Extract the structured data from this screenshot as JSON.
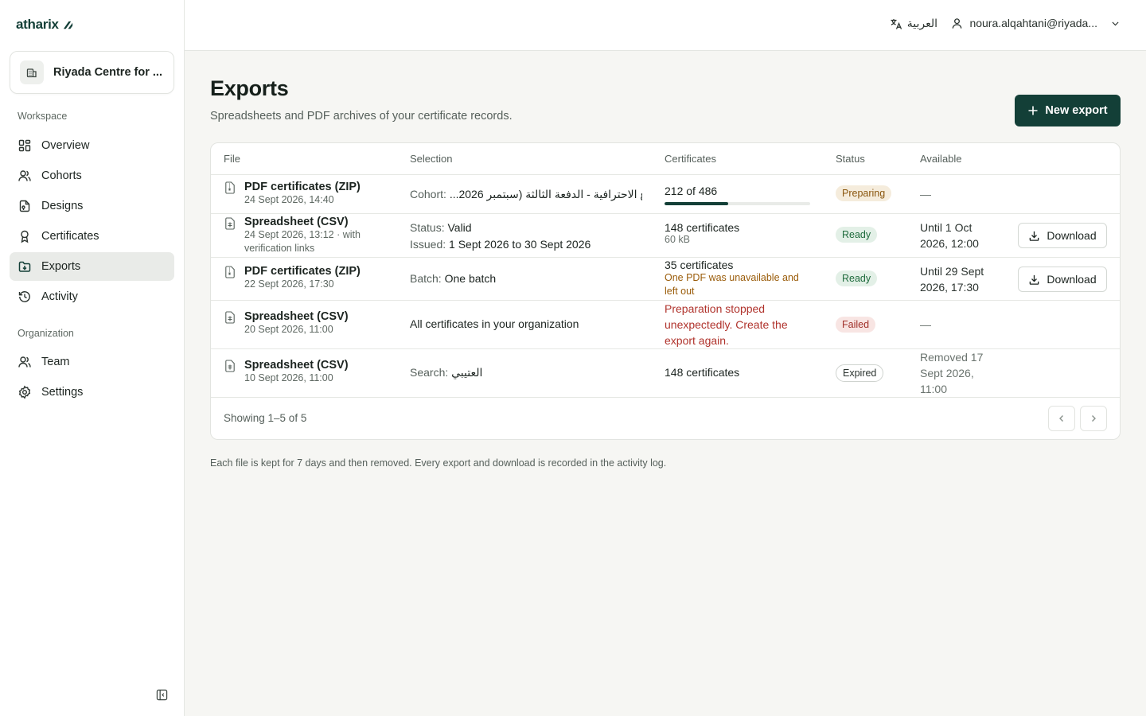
{
  "brand": {
    "name": "atharix"
  },
  "org": {
    "name": "Riyada Centre for ..."
  },
  "nav": {
    "workspace_label": "Workspace",
    "organization_label": "Organization",
    "items": [
      {
        "label": "Overview",
        "icon": "grid-icon"
      },
      {
        "label": "Cohorts",
        "icon": "users-icon"
      },
      {
        "label": "Designs",
        "icon": "design-icon"
      },
      {
        "label": "Certificates",
        "icon": "award-icon"
      },
      {
        "label": "Exports",
        "icon": "folder-download-icon",
        "active": true
      },
      {
        "label": "Activity",
        "icon": "history-icon"
      },
      {
        "label": "Team",
        "icon": "team-icon"
      },
      {
        "label": "Settings",
        "icon": "gear-icon"
      }
    ]
  },
  "topbar": {
    "language": "العربية",
    "user_email": "noura.alqahtani@riyada..."
  },
  "page": {
    "title": "Exports",
    "subtitle": "Spreadsheets and PDF archives of your certificate records.",
    "new_export_label": "New export",
    "footnote": "Each file is kept for 7 days and then removed. Every export and download is recorded in the activity log."
  },
  "table": {
    "headers": {
      "file": "File",
      "selection": "Selection",
      "certificates": "Certificates",
      "status": "Status",
      "available": "Available"
    },
    "rows": [
      {
        "file_title": "PDF certificates (ZIP)",
        "file_meta": "24 Sept 2026, 14:40",
        "selection_key": "Cohort:",
        "selection_value": "ع الاحترافية - الدفعة الثالثة (سبتمبر 2026...",
        "cert_main": "212 of 486",
        "progress": 0.436,
        "status": "Preparing",
        "available": "—"
      },
      {
        "file_title": "Spreadsheet (CSV)",
        "file_meta_1": "24 Sept 2026, 13:12 · with",
        "file_meta_2": "verification links",
        "sel1_key": "Status:",
        "sel1_value": "Valid",
        "sel2_key": "Issued:",
        "sel2_value": "1 Sept 2026 to 30 Sept 2026",
        "cert_main": "148 certificates",
        "cert_sub": "60 kB",
        "status": "Ready",
        "available_1": "Until 1 Oct",
        "available_2": "2026, 12:00",
        "action": "Download"
      },
      {
        "file_title": "PDF certificates (ZIP)",
        "file_meta": "22 Sept 2026, 17:30",
        "selection_key": "Batch:",
        "selection_value": "One batch",
        "cert_main": "35 certificates",
        "warn_1": "One PDF was unavailable and",
        "warn_2": "left out",
        "status": "Ready",
        "available_1": "Until 29 Sept",
        "available_2": "2026, 17:30",
        "action": "Download"
      },
      {
        "file_title": "Spreadsheet (CSV)",
        "file_meta": "20 Sept 2026, 11:00",
        "selection_value": "All certificates in your organization",
        "err_1": "Preparation stopped",
        "err_2": "unexpectedly. Create the",
        "err_3": "export again.",
        "status": "Failed",
        "available": "—"
      },
      {
        "file_title": "Spreadsheet (CSV)",
        "file_meta": "10 Sept 2026, 11:00",
        "selection_key": "Search:",
        "selection_value": "العتيبي",
        "cert_main": "148 certificates",
        "status": "Expired",
        "available_1": "Removed 17",
        "available_2": "Sept 2026,",
        "available_3": "11:00"
      }
    ],
    "showing": "Showing 1–5 of 5"
  },
  "colors": {
    "brand": "#133f37",
    "preparing": "#8a560e",
    "ready": "#1f6b3d",
    "failed": "#a1312b"
  }
}
